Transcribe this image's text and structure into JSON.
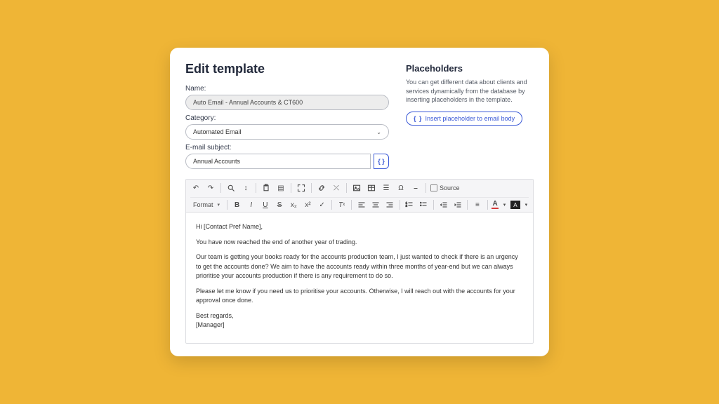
{
  "title": "Edit template",
  "labels": {
    "name": "Name:",
    "category": "Category:",
    "subject": "E-mail subject:"
  },
  "fields": {
    "name_value": "Auto Email - Annual Accounts & CT600",
    "category_value": "Automated Email",
    "subject_value": "Annual Accounts"
  },
  "placeholders": {
    "title": "Placeholders",
    "description": "You can get different data about clients and services dynamically from the database by inserting placeholders in the template.",
    "button": "Insert placeholder to email body",
    "bracket_glyph": "{ }"
  },
  "toolbar": {
    "format": "Format",
    "source": "Source"
  },
  "body": {
    "greeting": "Hi [Contact Pref Name],",
    "p1": "You have now reached the end of another year of trading.",
    "p2": "Our team is getting your books ready for the accounts production team, I just wanted to check if there is an urgency to get the accounts done? We aim to have the accounts ready within three months of year-end but we can always prioritise your accounts production if there is any requirement to do so.",
    "p3": "Please let me know if you need us to prioritise your accounts. Otherwise, I will reach out with the accounts for your approval once done.",
    "signoff1": "Best regards,",
    "signoff2": "[Manager]"
  }
}
